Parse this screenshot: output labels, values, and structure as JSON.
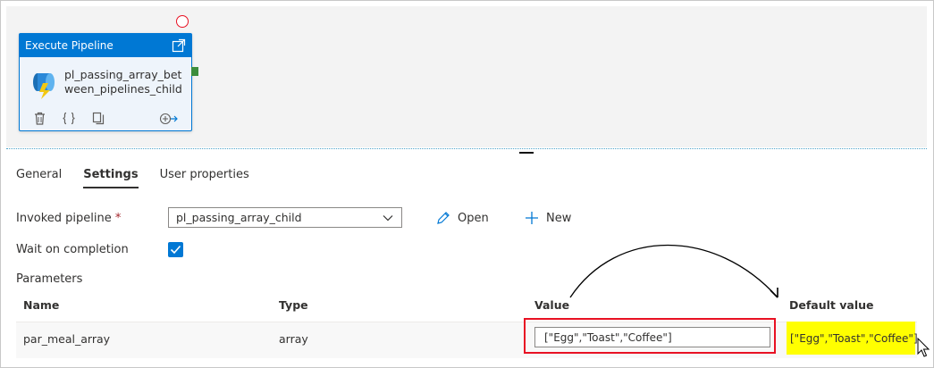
{
  "activity": {
    "header": "Execute Pipeline",
    "name": "pl_passing_array_between_pipelines_child",
    "icons": [
      "external-link-icon",
      "pipeline-icon",
      "delete-icon",
      "code-icon",
      "copy-icon",
      "add-output-icon"
    ]
  },
  "tabs": [
    {
      "label": "General"
    },
    {
      "label": "Settings"
    },
    {
      "label": "User properties"
    }
  ],
  "settings": {
    "invoked_pipeline_label": "Invoked pipeline",
    "required_mark": "*",
    "invoked_pipeline_value": "pl_passing_array_child",
    "open_label": "Open",
    "new_label": "New",
    "wait_label": "Wait on completion",
    "wait_checked": true,
    "parameters_label": "Parameters"
  },
  "parameters": {
    "headers": {
      "name": "Name",
      "type": "Type",
      "value": "Value",
      "default": "Default value"
    },
    "rows": [
      {
        "name": "par_meal_array",
        "type": "array",
        "value": "[\"Egg\",\"Toast\",\"Coffee\"]",
        "default": "[\"Egg\",\"Toast\",\"Coffee\"]"
      }
    ]
  },
  "colors": {
    "accent": "#0078d4",
    "highlight": "#ffff00",
    "annotation": "#e81123",
    "success": "#3c8d3c"
  }
}
